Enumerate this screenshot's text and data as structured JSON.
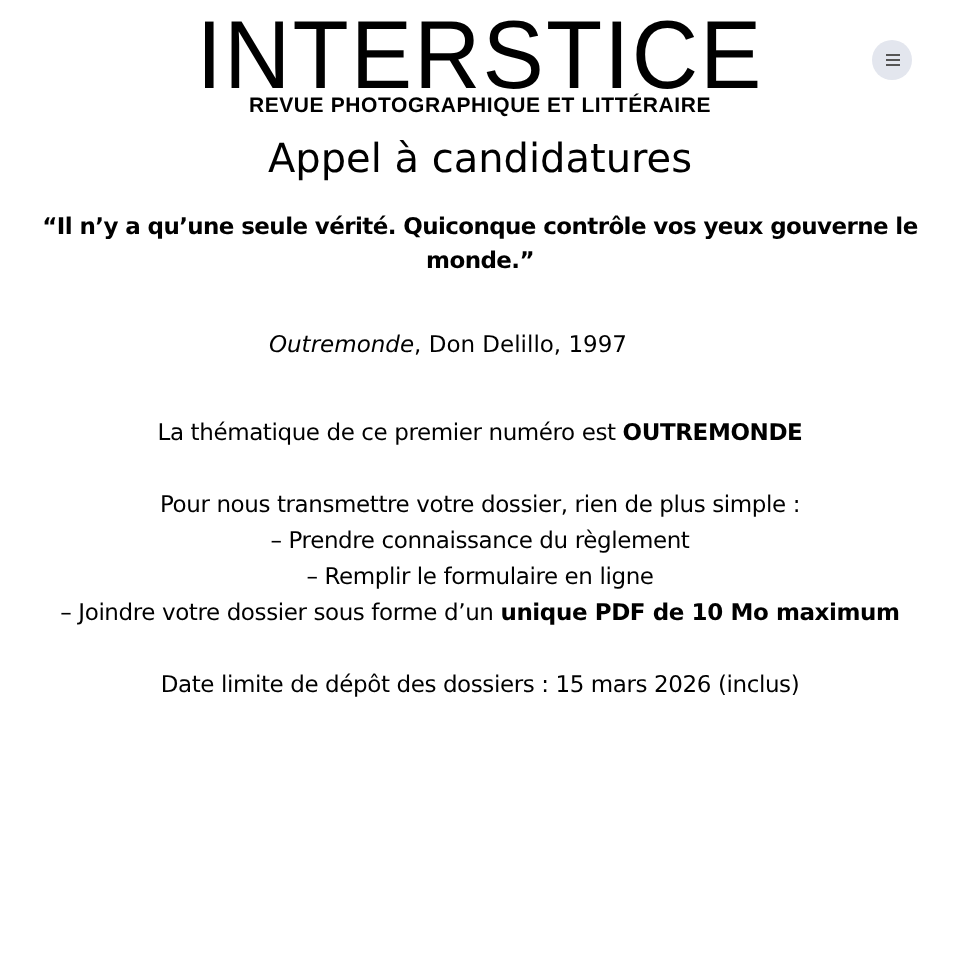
{
  "header": {
    "logo": "INTERSTICE",
    "tagline": "REVUE PHOTOGRAPHIQUE ET LITTÉRAIRE"
  },
  "title": "Appel à candidatures",
  "quote": "“Il n’y a qu’une seule vérité. Quiconque contrôle vos yeux gouverne le monde.”",
  "citation": "*Outremonde*, Don Delillo, 1997",
  "blocks": [
    [
      "La thématique de ce premier numéro est **OUTREMONDE**"
    ],
    [
      "Pour nous transmettre votre dossier, rien de plus simple :",
      "– Prendre connaissance du règlement",
      "– Remplir le formulaire en ligne",
      "– Joindre votre dossier sous forme d’un **unique PDF de 10 Mo maximum**"
    ],
    [
      "Date limite de dépôt des dossiers : 15 mars 2026 (inclus)"
    ]
  ]
}
